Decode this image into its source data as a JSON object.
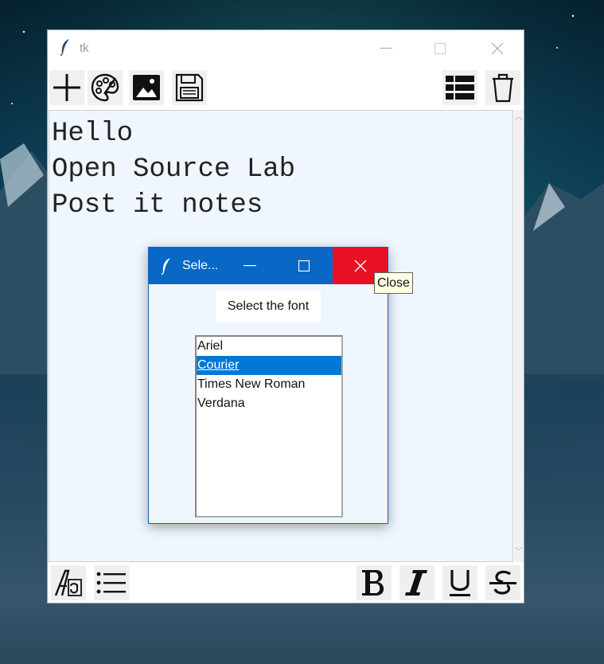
{
  "main_window": {
    "title": "tk",
    "text_lines": [
      "Hello",
      "Open Source Lab",
      "Post it notes"
    ],
    "toolbar_top": {
      "left_icons": [
        "plus-icon",
        "palette-icon",
        "image-icon",
        "save-icon"
      ],
      "right_icons": [
        "list-view-icon",
        "trash-icon"
      ]
    },
    "toolbar_bottom": {
      "left_icons": [
        "font-icon",
        "bullet-list-icon"
      ],
      "right_icons": [
        "bold-icon",
        "italic-icon",
        "underline-icon",
        "strikethrough-icon"
      ]
    }
  },
  "dialog": {
    "title": "Sele...",
    "label": "Select the font",
    "fonts": [
      "Ariel",
      "Courier",
      "Times New Roman",
      "Verdana"
    ],
    "selected": "Courier"
  },
  "tooltip": {
    "text": "Close"
  },
  "colors": {
    "dialog_titlebar": "#0967c5",
    "close_hover": "#e81123",
    "selection": "#0078d7",
    "text_background": "#eff6fd"
  }
}
